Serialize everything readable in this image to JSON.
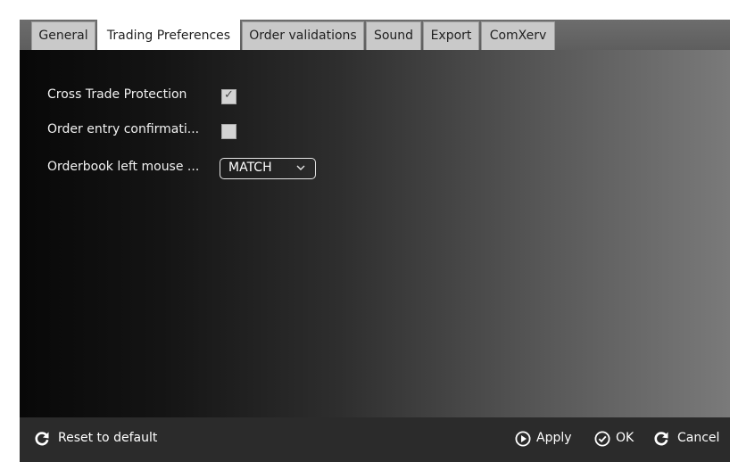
{
  "tabs": [
    {
      "label": "General"
    },
    {
      "label": "Trading Preferences"
    },
    {
      "label": "Order validations"
    },
    {
      "label": "Sound"
    },
    {
      "label": "Export"
    },
    {
      "label": "ComXerv"
    }
  ],
  "active_tab": "Trading Preferences",
  "settings": {
    "cross_trade_protection": {
      "label": "Cross Trade Protection",
      "checked": true
    },
    "order_entry_confirmation": {
      "label": "Order entry confirmati...",
      "checked": false
    },
    "orderbook_left_mouse": {
      "label": "Orderbook left mouse ...",
      "value": "MATCH"
    }
  },
  "footer": {
    "reset_label": "Reset to default",
    "apply_label": "Apply",
    "ok_label": "OK",
    "cancel_label": "Cancel"
  },
  "icons": {
    "reset": "refresh-icon",
    "apply": "play-circle-icon",
    "ok": "check-circle-icon",
    "cancel": "refresh-icon"
  },
  "colors": {
    "tab_bar": "#5e5e5e",
    "active_tab": "#ffffff",
    "tab": "#c9c9c9",
    "bottom_bar": "#2b2b2b",
    "text": "#ffffff"
  }
}
